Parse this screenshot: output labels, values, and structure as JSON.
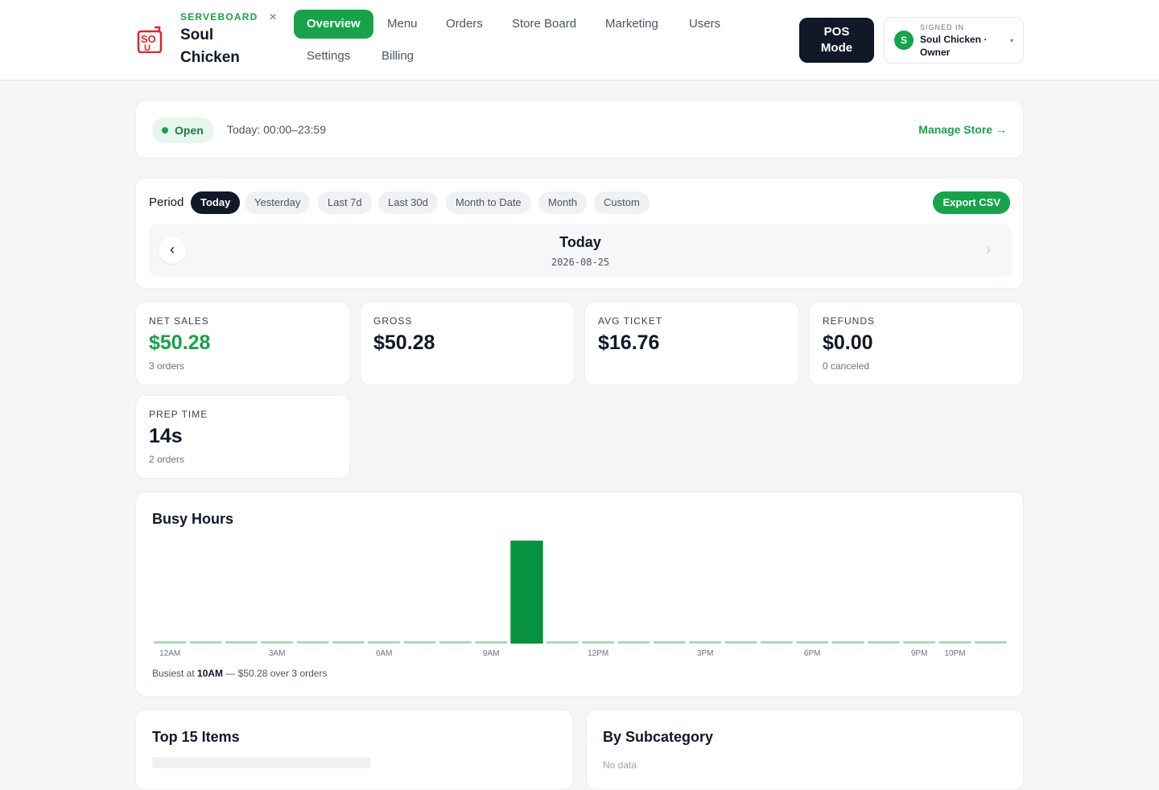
{
  "brand": {
    "kicker": "SERVEBOARD",
    "name": "Soul Chicken",
    "close": "×"
  },
  "nav": [
    {
      "label": "Overview",
      "active": true
    },
    {
      "label": "Menu"
    },
    {
      "label": "Orders"
    },
    {
      "label": "Store Board"
    },
    {
      "label": "Marketing"
    },
    {
      "label": "Users"
    },
    {
      "label": "Settings"
    },
    {
      "label": "Billing"
    }
  ],
  "pos_button": "POS Mode",
  "account": {
    "kicker": "SIGNED IN",
    "name": "Soul Chicken · Owner",
    "avatar": "S",
    "caret": "▾"
  },
  "status": {
    "badge": "Open",
    "hours": "Today: 00:00–23:59",
    "manage": "Manage Store →"
  },
  "period": {
    "label": "Period",
    "options": [
      "Today",
      "Yesterday",
      "Last 7d",
      "Last 30d",
      "Month to Date",
      "Month",
      "Custom"
    ],
    "selected": "Today",
    "export": "Export CSV",
    "date_title": "Today",
    "date_sub": "2026-08-25",
    "prev": "‹",
    "next": "›"
  },
  "metrics": {
    "net_sales": {
      "label": "NET SALES",
      "value": "$50.28",
      "sub": "3 orders"
    },
    "gross": {
      "label": "GROSS",
      "value": "$50.28"
    },
    "avg_ticket": {
      "label": "AVG TICKET",
      "value": "$16.76"
    },
    "refunds": {
      "label": "REFUNDS",
      "value": "$0.00",
      "sub": "0 canceled"
    },
    "prep_time": {
      "label": "PREP TIME",
      "value": "14s",
      "sub": "2 orders"
    }
  },
  "busy": {
    "title": "Busy Hours",
    "note_prefix": "Busiest at ",
    "note_hour": "10AM",
    "note_suffix": " — $50.28 over 3 orders"
  },
  "top_items": {
    "title": "Top 15 Items"
  },
  "subcategory": {
    "title": "By Subcategory",
    "empty": "No data"
  },
  "colors": {
    "accent": "#16a34a",
    "dark": "#111827",
    "bar": "#079240",
    "bar_empty": "#a7dcb9"
  },
  "chart_data": {
    "type": "bar",
    "title": "Busy Hours",
    "categories": [
      "12AM",
      "1AM",
      "2AM",
      "3AM",
      "4AM",
      "5AM",
      "6AM",
      "7AM",
      "8AM",
      "9AM",
      "10AM",
      "11AM",
      "12PM",
      "1PM",
      "2PM",
      "3PM",
      "4PM",
      "5PM",
      "6PM",
      "7PM",
      "8PM",
      "9PM",
      "10PM",
      "11PM"
    ],
    "tick_labels": [
      "12AM",
      "3AM",
      "6AM",
      "9AM",
      "12PM",
      "3PM",
      "6PM",
      "9PM",
      "10PM"
    ],
    "values": [
      0,
      0,
      0,
      0,
      0,
      0,
      0,
      0,
      0,
      0,
      50.28,
      0,
      0,
      0,
      0,
      0,
      0,
      0,
      0,
      0,
      0,
      0,
      0,
      0
    ],
    "grid": false
  }
}
